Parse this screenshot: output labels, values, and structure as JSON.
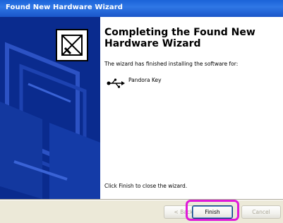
{
  "window": {
    "title": "Found New Hardware Wizard"
  },
  "main": {
    "heading": "Completing the Found New Hardware Wizard",
    "description": "The wizard has finished installing the software for:",
    "device_name": "Pandora Key",
    "close_hint": "Click Finish to close the wizard."
  },
  "buttons": {
    "back": "< Back",
    "finish": "Finish",
    "cancel": "Cancel"
  },
  "colors": {
    "titlebar": "#1b63d8",
    "sidepanel": "#0a2b8e",
    "highlight": "#e01ad8"
  },
  "icons": [
    "wizard-box-icon",
    "usb-icon"
  ]
}
